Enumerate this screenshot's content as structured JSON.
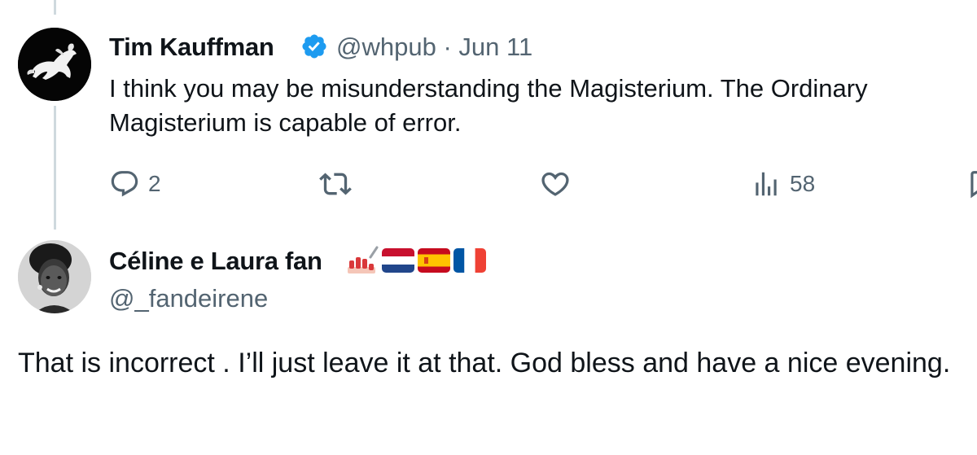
{
  "tweet1": {
    "author_name": "Tim Kauffman",
    "handle": "@whpub",
    "separator": "·",
    "date": "Jun 11",
    "verified": true,
    "text_line1": "I think you may be misunderstanding the Magisterium. The Ordinary",
    "text_line2": "Magisterium is capable of error.",
    "actions": {
      "reply_count": "2",
      "retweet_count": "",
      "like_count": "",
      "views_count": "58"
    },
    "icons": [
      "reply-icon",
      "retweet-icon",
      "like-icon",
      "views-icon",
      "bookmark-icon",
      "verified-badge-icon"
    ]
  },
  "tweet2": {
    "author_name": "Céline e Laura fan",
    "name_emoji": [
      "nail-polish",
      "netherlands-flag",
      "spain-flag",
      "france-flag"
    ],
    "handle": "@_fandeirene",
    "text": "That is incorrect . I’ll just leave it at that. God bless and have a nice evening."
  },
  "colors": {
    "text": "#0f1419",
    "secondary": "#536471",
    "verified": "#1d9bf0",
    "thread_line": "#cfd9de"
  }
}
